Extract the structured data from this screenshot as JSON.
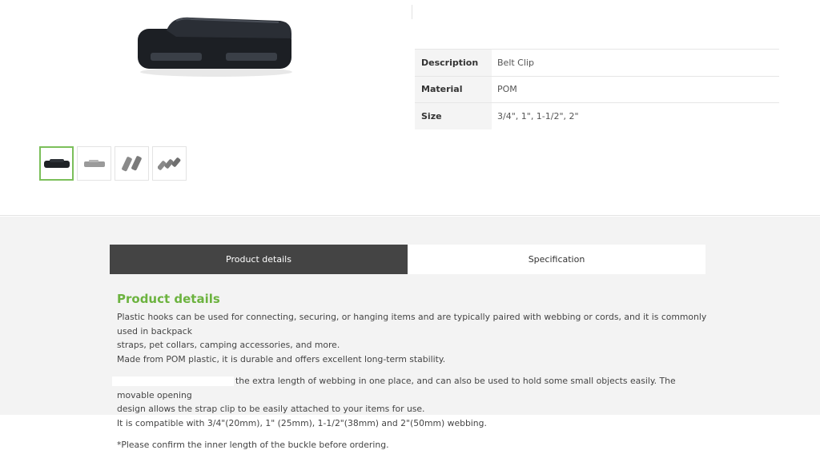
{
  "product": {
    "image_alt": "belt clip product image",
    "specs": [
      {
        "key": "Description",
        "value": "Belt Clip"
      },
      {
        "key": "Material",
        "value": "POM"
      },
      {
        "key": "Size",
        "value": "3/4\", 1\", 1-1/2\", 2\""
      }
    ],
    "thumbnails": [
      {
        "name": "thumb-black-clip",
        "active": true
      },
      {
        "name": "thumb-gray-clip",
        "active": false
      },
      {
        "name": "thumb-two-clips",
        "active": false
      },
      {
        "name": "thumb-three-clips",
        "active": false
      }
    ]
  },
  "tabs": [
    {
      "label": "Product details",
      "active": true
    },
    {
      "label": "Specification",
      "active": false
    }
  ],
  "details": {
    "title": "Product details",
    "p1_line1": "Plastic hooks can be used for connecting, securing, or hanging items and are typically paired with webbing or cords, and it is commonly used in backpack",
    "p1_line2": "straps, pet collars, camping accessories, and more.",
    "p1_line3": "Made from POM plastic, it is durable and offers excellent long-term stability.",
    "p2_line1": "the extra length of webbing in one place, and can also be used to hold some small objects easily. The movable opening",
    "p2_line2": "design allows the strap clip to be easily attached to your items for use.",
    "p2_line3": "It is compatible with 3/4\"(20mm), 1\" (25mm), 1-1/2\"(38mm) and 2\"(50mm) webbing.",
    "note": "*Please confirm the inner length of the buckle before ordering."
  },
  "colors": {
    "accent_green": "#6cb33f",
    "tab_active_bg": "#444444"
  }
}
